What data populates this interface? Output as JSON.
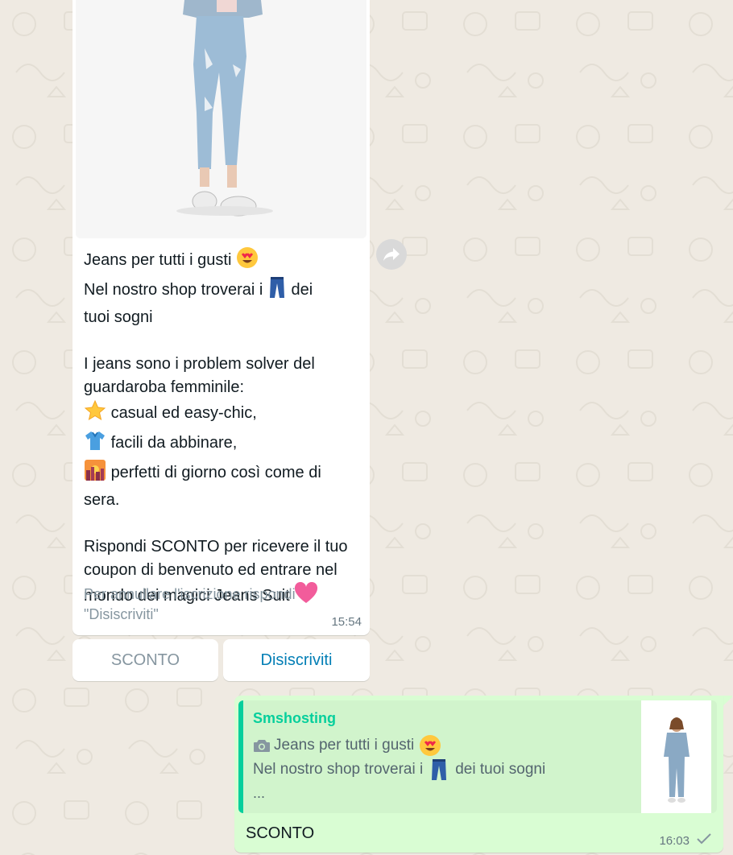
{
  "incoming": {
    "emoji_heart_eyes": "heart-eyes-emoji",
    "line1": "Jeans per tutti i gusti",
    "line2_pre": "Nel nostro shop troverai i",
    "line2_post": "dei",
    "line3": "tuoi sogni",
    "para2_line1": "I jeans sono i problem solver del",
    "para2_line2": "guardaroba femminile:",
    "bullet1": "casual ed easy-chic,",
    "bullet2": "facili da abbinare,",
    "bullet3_line1": "perfetti di giorno così come di",
    "bullet3_line2": "sera.",
    "para3_line1": "Rispondi SCONTO per ricevere il tuo",
    "para3_line2": "coupon di benvenuto ed entrare nel",
    "para3_line3": "mondo dei magici Jeans Suit",
    "footer": "Per annullare l'iscrizione rispondi \"Disiscriviti\"",
    "time": "15:54"
  },
  "quick_replies": {
    "btn1": "SCONTO",
    "btn2": "Disiscriviti"
  },
  "outgoing": {
    "quote_sender": "Smshosting",
    "quote_line1": "Jeans per tutti i gusti",
    "quote_line2_pre": "Nel nostro shop troverai i",
    "quote_line2_post": "dei tuoi sogni",
    "quote_line3": "...",
    "text": "SCONTO",
    "time": "16:03"
  },
  "colors": {
    "wallpaper": "#efeae2",
    "outgoing_bubble": "#d9fdd3",
    "quote_accent": "#06cf9c",
    "link_blue": "#027eb5"
  }
}
